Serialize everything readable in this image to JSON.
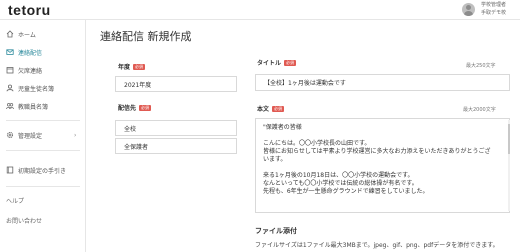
{
  "app": {
    "logo": "tetoru"
  },
  "user": {
    "role": "学校管理者",
    "school": "手取デモ校"
  },
  "sidebar": {
    "items": [
      {
        "label": "ホーム",
        "icon": "home-icon"
      },
      {
        "label": "連絡配信",
        "icon": "mail-icon",
        "active": true
      },
      {
        "label": "欠席連絡",
        "icon": "calendar-icon"
      },
      {
        "label": "児童生徒名簿",
        "icon": "person-icon"
      },
      {
        "label": "教職員名簿",
        "icon": "group-icon"
      }
    ],
    "settings": {
      "label": "管理設定",
      "icon": "gear-icon"
    },
    "guide": {
      "label": "初期設定の手引き",
      "icon": "book-icon"
    },
    "help": "ヘルプ",
    "contact": "お問い合わせ"
  },
  "page": {
    "title": "連絡配信 新規作成"
  },
  "form": {
    "required_badge": "必須",
    "year": {
      "label": "年度",
      "value": "2021年度"
    },
    "recipients": {
      "label": "配信先",
      "values": [
        "全校",
        "全保護者"
      ]
    },
    "title": {
      "label": "タイトル",
      "max": "最大250文字",
      "value": "【全校】1ヶ月後は運動会です"
    },
    "body": {
      "label": "本文",
      "max": "最大2000文字",
      "lines": [
        "\"保護者の皆様",
        "",
        "こんにちは。〇〇小学校長の山田です。",
        "皆様にお知らせしては平素より学校運営に多大なお力添えをいただきありがとうござ",
        "います。",
        "",
        "来る1ヶ月後の10月18日は、〇〇小学校の運動会です。",
        "なんといっても〇〇小学校では伝統の総体操が有名です。",
        "先程も、6年生が一生懸命グラウンドで練習をしていました。"
      ]
    },
    "attachment": {
      "title": "ファイル添付",
      "note": "ファイルサイズは1ファイル最大3MBまで。jpeg、gif、png、pdfデータを添付できます。"
    }
  }
}
